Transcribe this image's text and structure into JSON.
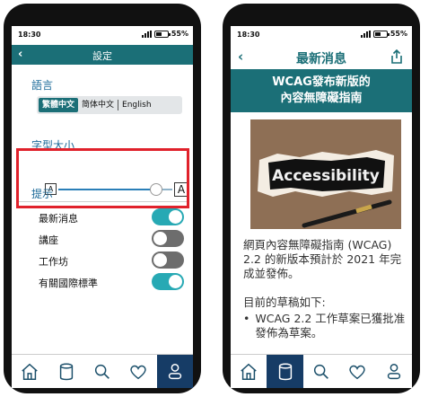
{
  "status": {
    "time": "18:30",
    "battery": "55%"
  },
  "settings_screen": {
    "back": "‹",
    "title": "設定",
    "language": {
      "label": "語言",
      "options": [
        "繁體中文",
        "简体中文",
        "English"
      ],
      "selected": "繁體中文"
    },
    "font_size": {
      "label": "字型大小",
      "small_glyph": "A",
      "large_glyph": "A",
      "level": 0.86
    },
    "notifications": {
      "label": "提示",
      "items": [
        {
          "label": "最新消息",
          "on": true
        },
        {
          "label": "講座",
          "on": false
        },
        {
          "label": "工作坊",
          "on": false
        },
        {
          "label": "有關國際標準",
          "on": true
        }
      ]
    },
    "active_tab": "profile"
  },
  "news_screen": {
    "back": "‹",
    "title": "最新消息",
    "banner_line1": "WCAG發布新版的",
    "banner_line2": "內容無障礙指南",
    "image_word": "Accessibility",
    "para1": "網頁內容無障礙指南 (WCAG) 2.2 的新版本預計於 2021 年完成並發佈。",
    "para2": "目前的草稿如下:",
    "bullet1": "WCAG 2.2 工作草案已獲批准發佈為草案。",
    "active_tab": "library"
  },
  "tabs": [
    "home-icon",
    "library-icon",
    "search-icon",
    "heart-icon",
    "profile-icon"
  ],
  "colors": {
    "teal": "#1b6f77",
    "navy": "#163c66",
    "highlight": "#e0212b",
    "toggle_on": "#27a9b4",
    "toggle_off": "#6d6d6d"
  }
}
